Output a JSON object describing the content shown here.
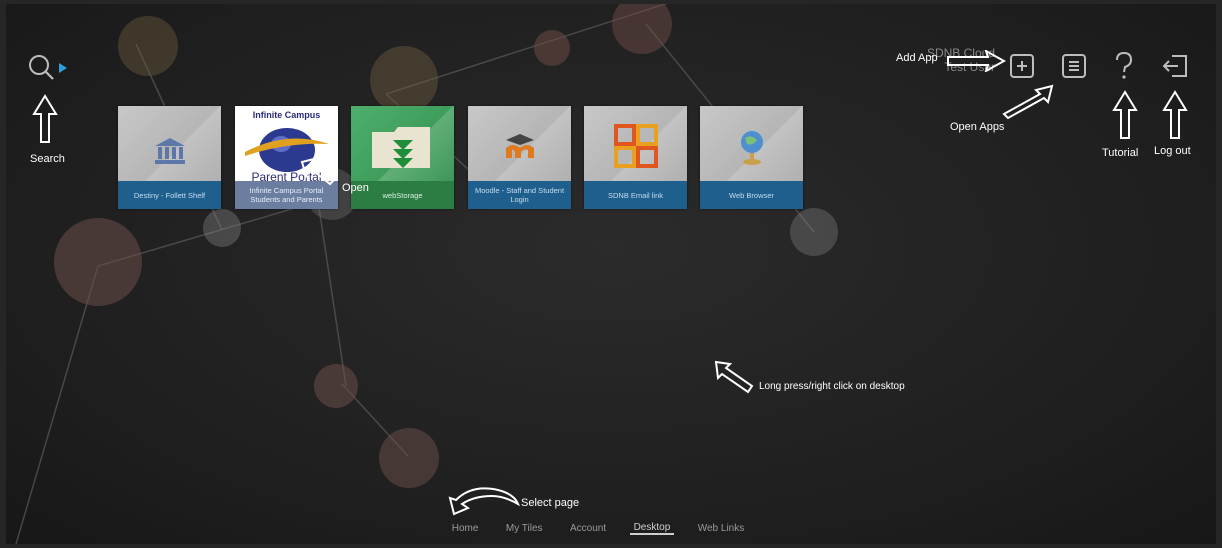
{
  "header": {
    "org_name": "SDNB Cloud",
    "user_name": "Test User",
    "add_app_note": "Add App",
    "open_apps_note": "Open Apps",
    "tutorial_note": "Tutorial",
    "logout_note": "Log out"
  },
  "search": {
    "note": "Search"
  },
  "tiles": [
    {
      "label": "Destiny - Follett Shelf",
      "icon": "library-icon"
    },
    {
      "label": "Infinite Campus Portal Students and Parents",
      "icon": "infinite-campus-logo",
      "logo_top": "Infinite Campus",
      "logo_bottom": "Parent Portal"
    },
    {
      "label": "webStorage",
      "icon": "folder-download-icon"
    },
    {
      "label": "Moodle - Staff and Student Login",
      "icon": "moodle-icon"
    },
    {
      "label": "SDNB Email link",
      "icon": "office-icon"
    },
    {
      "label": "Web Browser",
      "icon": "globe-icon"
    }
  ],
  "annotations": {
    "open": "Open",
    "desktop_hint": "Long press/right click on desktop",
    "select_page": "Select page"
  },
  "tabs": [
    {
      "label": "Home"
    },
    {
      "label": "My Tiles"
    },
    {
      "label": "Account"
    },
    {
      "label": "Desktop"
    },
    {
      "label": "Web Links"
    }
  ],
  "active_tab": "Desktop",
  "colors": {
    "tile_label_blue": "#1e5f8e",
    "tile_green": "#2f8c4a",
    "accent_arrow": "#2a9fd8"
  }
}
